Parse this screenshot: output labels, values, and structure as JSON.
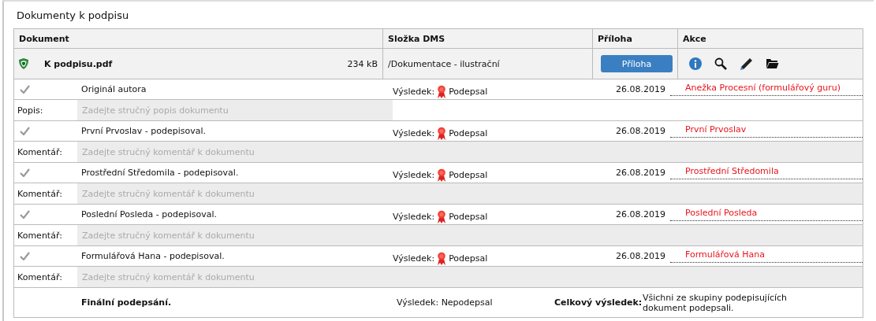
{
  "section_title": "Dokumenty k podpisu",
  "table": {
    "columns": [
      "Dokument",
      "Složka DMS",
      "Příloha",
      "Akce"
    ],
    "document": {
      "name": "K podpisu.pdf",
      "size": "234 kB",
      "folder": "/Dokumentace - ilustrační",
      "attachment_button": "Příloha"
    },
    "rows": [
      {
        "kind": "signer",
        "checked": true,
        "name": "Originál autora",
        "result_label": "Výsledek:",
        "result": "Podepsal",
        "date": "26.08.2019",
        "signer": "Anežka Procesní (formulářový guru)"
      },
      {
        "kind": "note",
        "label": "Popis:",
        "placeholder": "Zadejte stručný popis dokumentu",
        "wide": false
      },
      {
        "kind": "signer",
        "checked": true,
        "name": "První Prvoslav - podepisoval.",
        "result_label": "Výsledek:",
        "result": "Podepsal",
        "date": "26.08.2019",
        "signer": "První Prvoslav"
      },
      {
        "kind": "note",
        "label": "Komentář:",
        "placeholder": "Zadejte stručný komentář k dokumentu",
        "wide": true
      },
      {
        "kind": "signer",
        "checked": true,
        "name": "Prostřední Středomila - podepisoval.",
        "result_label": "Výsledek:",
        "result": "Podepsal",
        "date": "26.08.2019",
        "signer": "Prostřední Středomila"
      },
      {
        "kind": "note",
        "label": "Komentář:",
        "placeholder": "Zadejte stručný komentář k dokumentu",
        "wide": true
      },
      {
        "kind": "signer",
        "checked": true,
        "name": "Poslední Posleda - podepisoval.",
        "result_label": "Výsledek:",
        "result": "Podepsal",
        "date": "26.08.2019",
        "signer": "Poslední Posleda"
      },
      {
        "kind": "note",
        "label": "Komentář:",
        "placeholder": "Zadejte stručný komentář k dokumentu",
        "wide": true
      },
      {
        "kind": "signer",
        "checked": true,
        "name": "Formulářová Hana - podepisoval.",
        "result_label": "Výsledek:",
        "result": "Podepsal",
        "date": "26.08.2019",
        "signer": "Formulářová Hana"
      },
      {
        "kind": "note",
        "label": "Komentář:",
        "placeholder": "Zadejte stručný komentář k dokumentu",
        "wide": true
      },
      {
        "kind": "final",
        "name": "Finální podepsání.",
        "result_label": "Výsledek:",
        "result": "Nepodepsal",
        "total_label": "Celkový výsledek:",
        "total": "Všichni ze skupiny podepisujících dokument podepsali."
      }
    ]
  }
}
